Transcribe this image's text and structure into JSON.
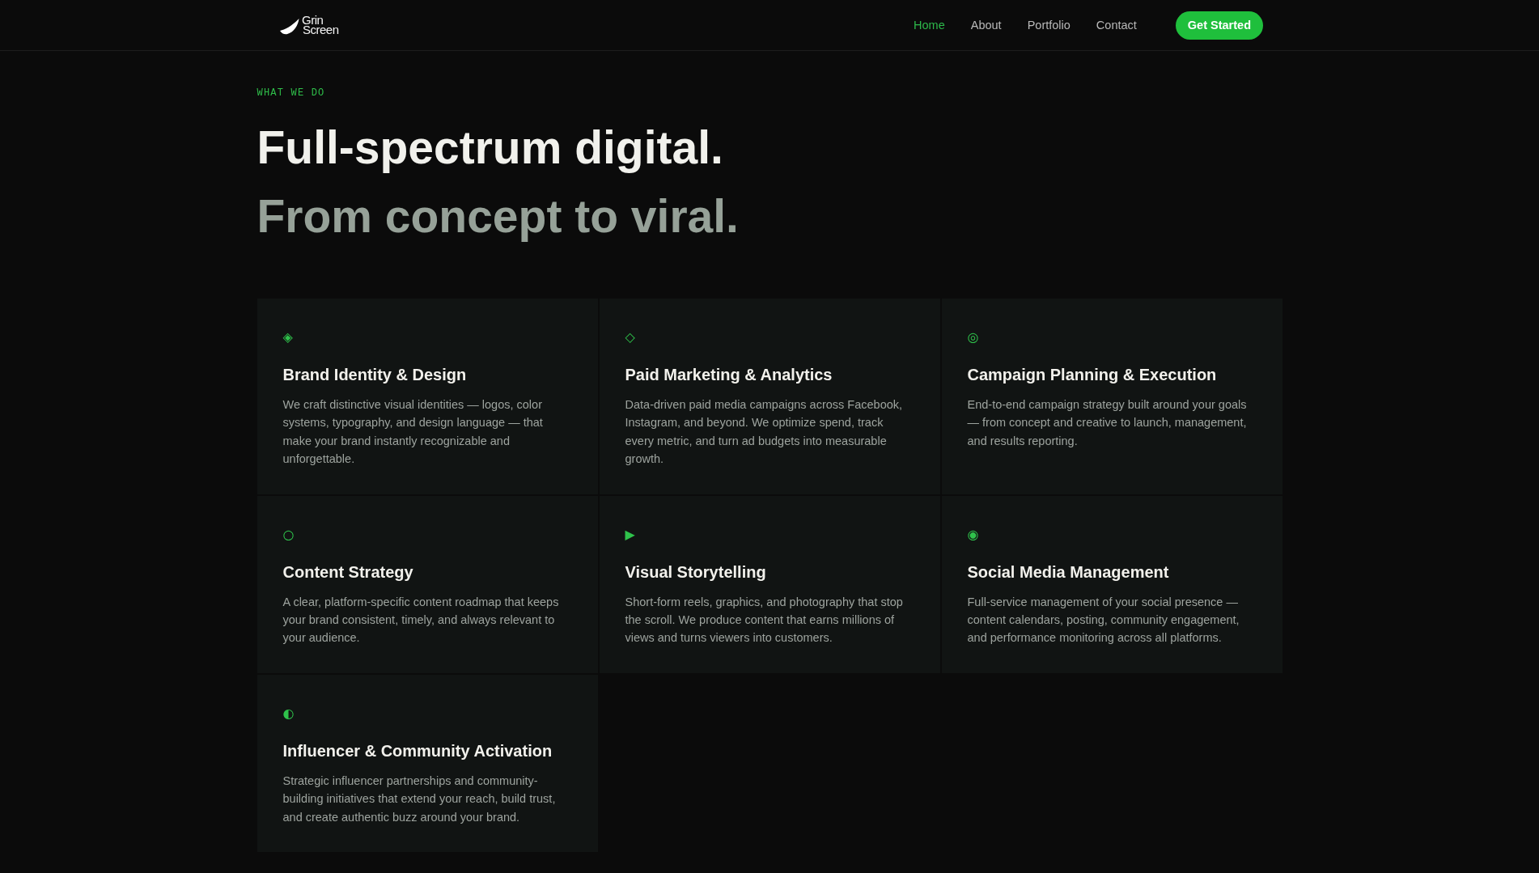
{
  "header": {
    "logo": {
      "wordmark": [
        "Grin",
        "Screen"
      ]
    },
    "nav": [
      {
        "label": "Home",
        "selected": true
      },
      {
        "label": "About",
        "selected": false
      },
      {
        "label": "Portfolio",
        "selected": false
      },
      {
        "label": "Contact",
        "selected": false
      }
    ],
    "cta": "Get Started"
  },
  "section": {
    "eyebrow": "WHAT WE DO",
    "title": "Full-spectrum digital.",
    "subtitle": "From concept to viral.",
    "services": [
      {
        "icon": "◈",
        "title": "Brand Identity & Design",
        "description": "We craft distinctive visual identities — logos, color systems, typography, and design language — that make your brand instantly recognizable and unforgettable."
      },
      {
        "icon": "◇",
        "title": "Paid Marketing & Analytics",
        "description": "Data-driven paid media campaigns across Facebook, Instagram, and beyond. We optimize spend, track every metric, and turn ad budgets into measurable growth."
      },
      {
        "icon": "◎",
        "title": "Campaign Planning & Execution",
        "description": "End-to-end campaign strategy built around your goals — from concept and creative to launch, management, and results reporting."
      },
      {
        "icon": "○",
        "title": "Content Strategy",
        "description": "A clear, platform-specific content roadmap that keeps your brand consistent, timely, and always relevant to your audience."
      },
      {
        "icon": "▶",
        "title": "Visual Storytelling",
        "description": "Short-form reels, graphics, and photography that stop the scroll. We produce content that earns millions of views and turns viewers into customers."
      },
      {
        "icon": "◉",
        "title": "Social Media Management",
        "description": "Full-service management of your social presence — content calendars, posting, community engagement, and performance monitoring across all platforms."
      },
      {
        "icon": "◐",
        "title": "Influencer & Community Activation",
        "description": "Strategic influencer partnerships and community-building initiatives that extend your reach, build trust, and create authentic buzz around your brand."
      }
    ]
  }
}
